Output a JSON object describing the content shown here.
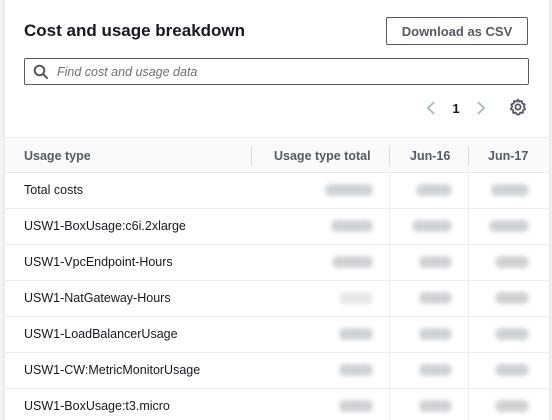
{
  "section": {
    "title": "Cost and usage breakdown",
    "download_label": "Download as CSV"
  },
  "search": {
    "placeholder": "Find cost and usage data",
    "value": ""
  },
  "pagination": {
    "current_page": "1"
  },
  "icons": {
    "search": "search-icon",
    "prev": "chevron-left-icon",
    "next": "chevron-right-icon",
    "settings": "gear-icon"
  },
  "colors": {
    "border_dark": "#545b64",
    "text_primary": "#16191f",
    "header_bg": "#fafafa"
  },
  "table": {
    "columns": [
      "Usage type",
      "Usage type total",
      "Jun-16",
      "Jun-17"
    ],
    "rows": [
      {
        "usage_type": "Total costs"
      },
      {
        "usage_type": "USW1-BoxUsage:c6i.2xlarge"
      },
      {
        "usage_type": "USW1-VpcEndpoint-Hours"
      },
      {
        "usage_type": "USW1-NatGateway-Hours"
      },
      {
        "usage_type": "USW1-LoadBalancerUsage"
      },
      {
        "usage_type": "USW1-CW:MetricMonitorUsage"
      },
      {
        "usage_type": "USW1-BoxUsage:t3.micro"
      }
    ]
  }
}
